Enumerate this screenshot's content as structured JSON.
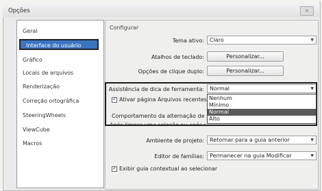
{
  "window": {
    "title": "Opções",
    "close_label": "✕"
  },
  "sidebar": {
    "items": [
      {
        "label": "Geral"
      },
      {
        "label": "Interface do usuário"
      },
      {
        "label": "Gráfico"
      },
      {
        "label": "Locais de arquivos"
      },
      {
        "label": "Renderização"
      },
      {
        "label": "Correção ortográfica"
      },
      {
        "label": "SteeringWheels"
      },
      {
        "label": "ViewCube"
      },
      {
        "label": "Macros"
      }
    ],
    "selected": "Interface do usuário"
  },
  "configure": {
    "group_title": "Configurar",
    "tema": {
      "label": "Tema ativo:",
      "value": "Claro"
    },
    "atalhos": {
      "label": "Atalhos de teclado:",
      "button": "Personalizar..."
    },
    "clique": {
      "label": "Opções de clique duplo:",
      "button": "Personalizar..."
    },
    "dica": {
      "label": "Assistência de dica de ferramenta:",
      "value": "Normal",
      "options": [
        "Nenhum",
        "Mínimo",
        "Normal",
        "Alto"
      ],
      "highlighted": "Normal"
    },
    "ativar_pagina": {
      "label": "Ativar página Arquivos recentes ao",
      "checked": true
    },
    "comportamento": {
      "label": "Comportamento da alternação de guia"
    },
    "apos_limpar": {
      "label": "Após limpar uma seleção ou após sair"
    },
    "ambiente": {
      "label": "Ambiente de projeto:",
      "value": "Retornar para a guia anterior"
    },
    "editor": {
      "label": "Editor de famílias:",
      "value": "Permanecer na guia Modificar"
    },
    "exibir_guia": {
      "label": "Exibir guia contextual ao selecionar",
      "checked": true
    }
  },
  "colors": {
    "selection": "#3c74c0",
    "dropdown_highlight": "#5a5a5a"
  }
}
